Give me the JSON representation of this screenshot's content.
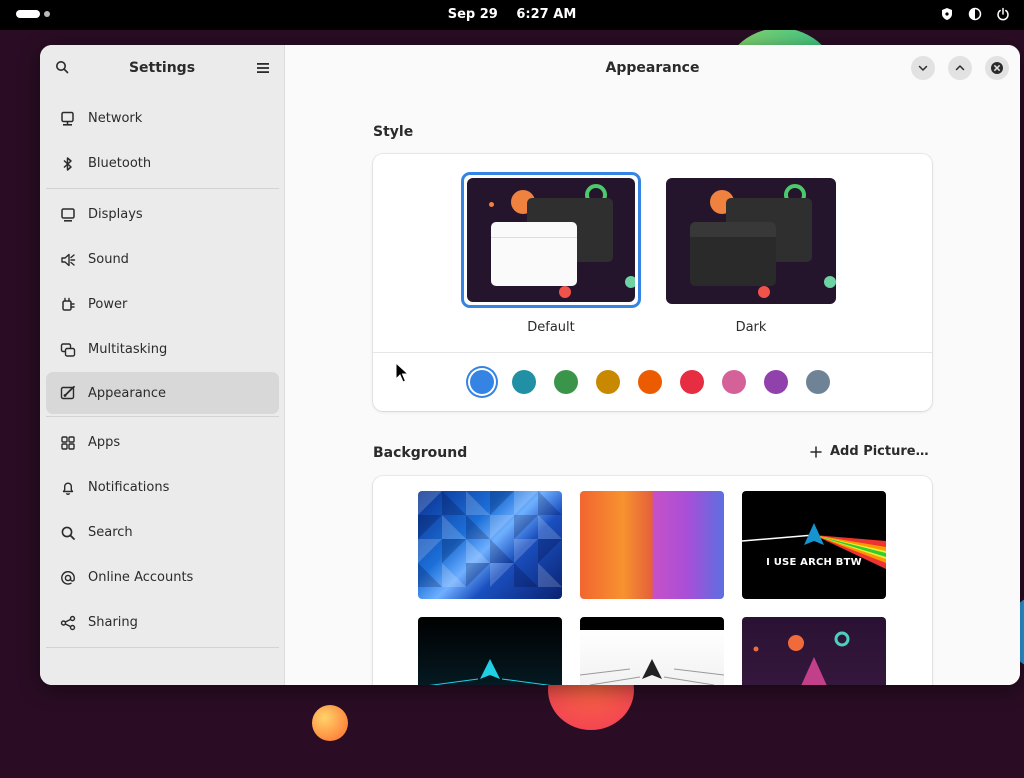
{
  "topbar": {
    "date": "Sep 29",
    "time": "6:27 AM",
    "tray_icons": [
      "shield-icon",
      "volume-icon",
      "power-icon"
    ]
  },
  "sidebar": {
    "title": "Settings",
    "items": [
      {
        "label": "Network",
        "icon": "network-icon"
      },
      {
        "label": "Bluetooth",
        "icon": "bluetooth-icon"
      },
      {
        "label": "Displays",
        "icon": "display-icon"
      },
      {
        "label": "Sound",
        "icon": "sound-icon"
      },
      {
        "label": "Power",
        "icon": "power-plug-icon"
      },
      {
        "label": "Multitasking",
        "icon": "multitasking-icon"
      },
      {
        "label": "Appearance",
        "icon": "appearance-icon",
        "active": true
      },
      {
        "label": "Apps",
        "icon": "apps-grid-icon"
      },
      {
        "label": "Notifications",
        "icon": "bell-icon"
      },
      {
        "label": "Search",
        "icon": "search-icon"
      },
      {
        "label": "Online Accounts",
        "icon": "at-sign-icon"
      },
      {
        "label": "Sharing",
        "icon": "share-icon"
      }
    ]
  },
  "main": {
    "title": "Appearance",
    "style_section": {
      "label": "Style",
      "options": [
        {
          "label": "Default",
          "selected": true
        },
        {
          "label": "Dark",
          "selected": false
        }
      ],
      "accent_colors": [
        "#3584e4",
        "#2190a4",
        "#3a944a",
        "#c88800",
        "#ed5b00",
        "#e62d42",
        "#d56199",
        "#9141ac",
        "#6f8396"
      ],
      "selected_accent": "#3584e4"
    },
    "background_section": {
      "label": "Background",
      "add_picture_label": "Add Picture…",
      "wallpaper_texts": [
        "I USE ARCH BTW"
      ]
    }
  },
  "colors": {
    "accent": "#3584e4",
    "sidebar_bg": "#ebebeb",
    "content_bg": "#fafafa"
  }
}
